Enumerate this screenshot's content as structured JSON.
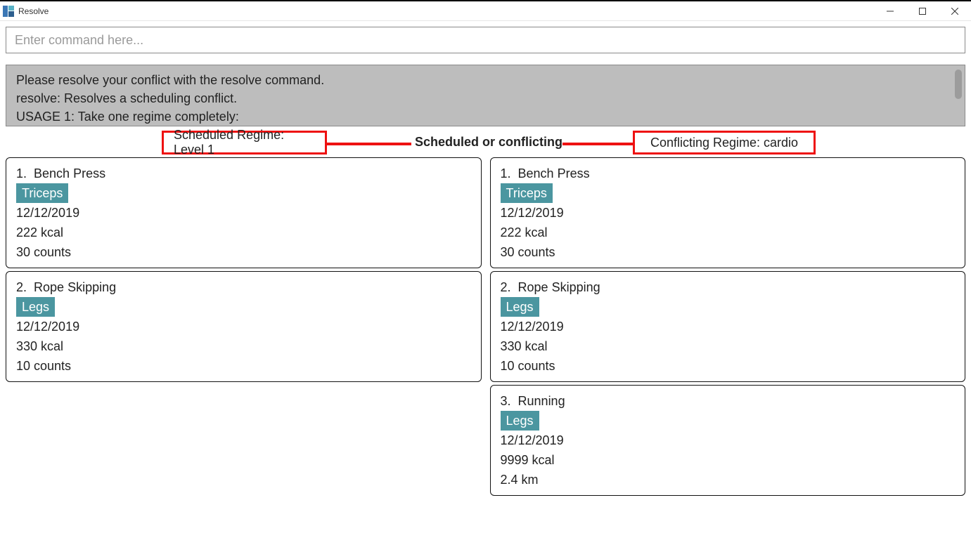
{
  "window": {
    "title": "Resolve"
  },
  "command_input": {
    "placeholder": "Enter command here...",
    "value": ""
  },
  "help": {
    "line1": "Please resolve your conflict with the resolve command.",
    "line2": "resolve: Resolves a scheduling conflict.",
    "line3": "USAGE 1: Take one regime completely:"
  },
  "headers": {
    "scheduled": "Scheduled Regime: Level 1",
    "center": "Scheduled or conflicting",
    "conflicting": "Conflicting Regime: cardio"
  },
  "colors": {
    "highlight_box": "#e11",
    "tag_bg": "#4b96a0",
    "help_bg": "#bdbdbd"
  },
  "scheduled_regime": [
    {
      "idx": "1.",
      "name": "Bench Press",
      "tag": "Triceps",
      "date": "12/12/2019",
      "kcal": "222 kcal",
      "qty": "30 counts"
    },
    {
      "idx": "2.",
      "name": "Rope Skipping",
      "tag": "Legs",
      "date": "12/12/2019",
      "kcal": "330 kcal",
      "qty": "10 counts"
    }
  ],
  "conflicting_regime": [
    {
      "idx": "1.",
      "name": "Bench Press",
      "tag": "Triceps",
      "date": "12/12/2019",
      "kcal": "222 kcal",
      "qty": "30 counts"
    },
    {
      "idx": "2.",
      "name": "Rope Skipping",
      "tag": "Legs",
      "date": "12/12/2019",
      "kcal": "330 kcal",
      "qty": "10 counts"
    },
    {
      "idx": "3.",
      "name": "Running",
      "tag": "Legs",
      "date": "12/12/2019",
      "kcal": "9999 kcal",
      "qty": "2.4 km"
    }
  ]
}
